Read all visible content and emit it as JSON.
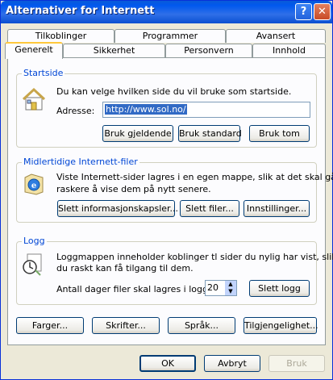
{
  "window": {
    "title": "Alternativer for Internett"
  },
  "titlebar": {
    "help": "?",
    "close": "✕"
  },
  "tabs": {
    "row1": [
      "Tilkoblinger",
      "Programmer",
      "Avansert"
    ],
    "row2": [
      "Generelt",
      "Sikkerhet",
      "Personvern",
      "Innhold"
    ],
    "active": "Generelt"
  },
  "startside": {
    "title": "Startside",
    "description": "Du kan velge hvilken side du vil bruke som startside.",
    "address_label": "Adresse:",
    "address_value": "http://www.sol.no/",
    "buttons": [
      "Bruk gjeldende",
      "Bruk standard",
      "Bruk tom"
    ],
    "icon": "home-page-icon"
  },
  "temp_files": {
    "title": "Midlertidige Internett-filer",
    "line1": "Viste Internett-sider lagres i en egen mappe, slik at det skal gå",
    "line2": "raskere å vise dem på nytt senere.",
    "buttons": [
      "Slett informasjonskapsler...",
      "Slett filer...",
      "Innstillinger..."
    ],
    "icon": "internet-explorer-page-icon"
  },
  "history": {
    "title": "Logg",
    "line1": "Loggmappen inneholder koblinger tl sider du nylig har vist, slik at",
    "line2": "du raskt kan få tilgang til dem.",
    "days_label": "Antall dager filer skal lagres i logger:",
    "days_value": "20",
    "clear_button": "Slett logg",
    "icon": "history-clock-icon"
  },
  "bottom_buttons": [
    "Farger...",
    "Skrifter...",
    "Språk...",
    "Tilgjengelighet..."
  ],
  "dialog_buttons": {
    "ok": "OK",
    "cancel": "Avbryt",
    "apply": "Bruk"
  },
  "colors": {
    "title_blue": "#0058ee",
    "group_title": "#0046d5",
    "tab_highlight": "#ffc83c"
  }
}
